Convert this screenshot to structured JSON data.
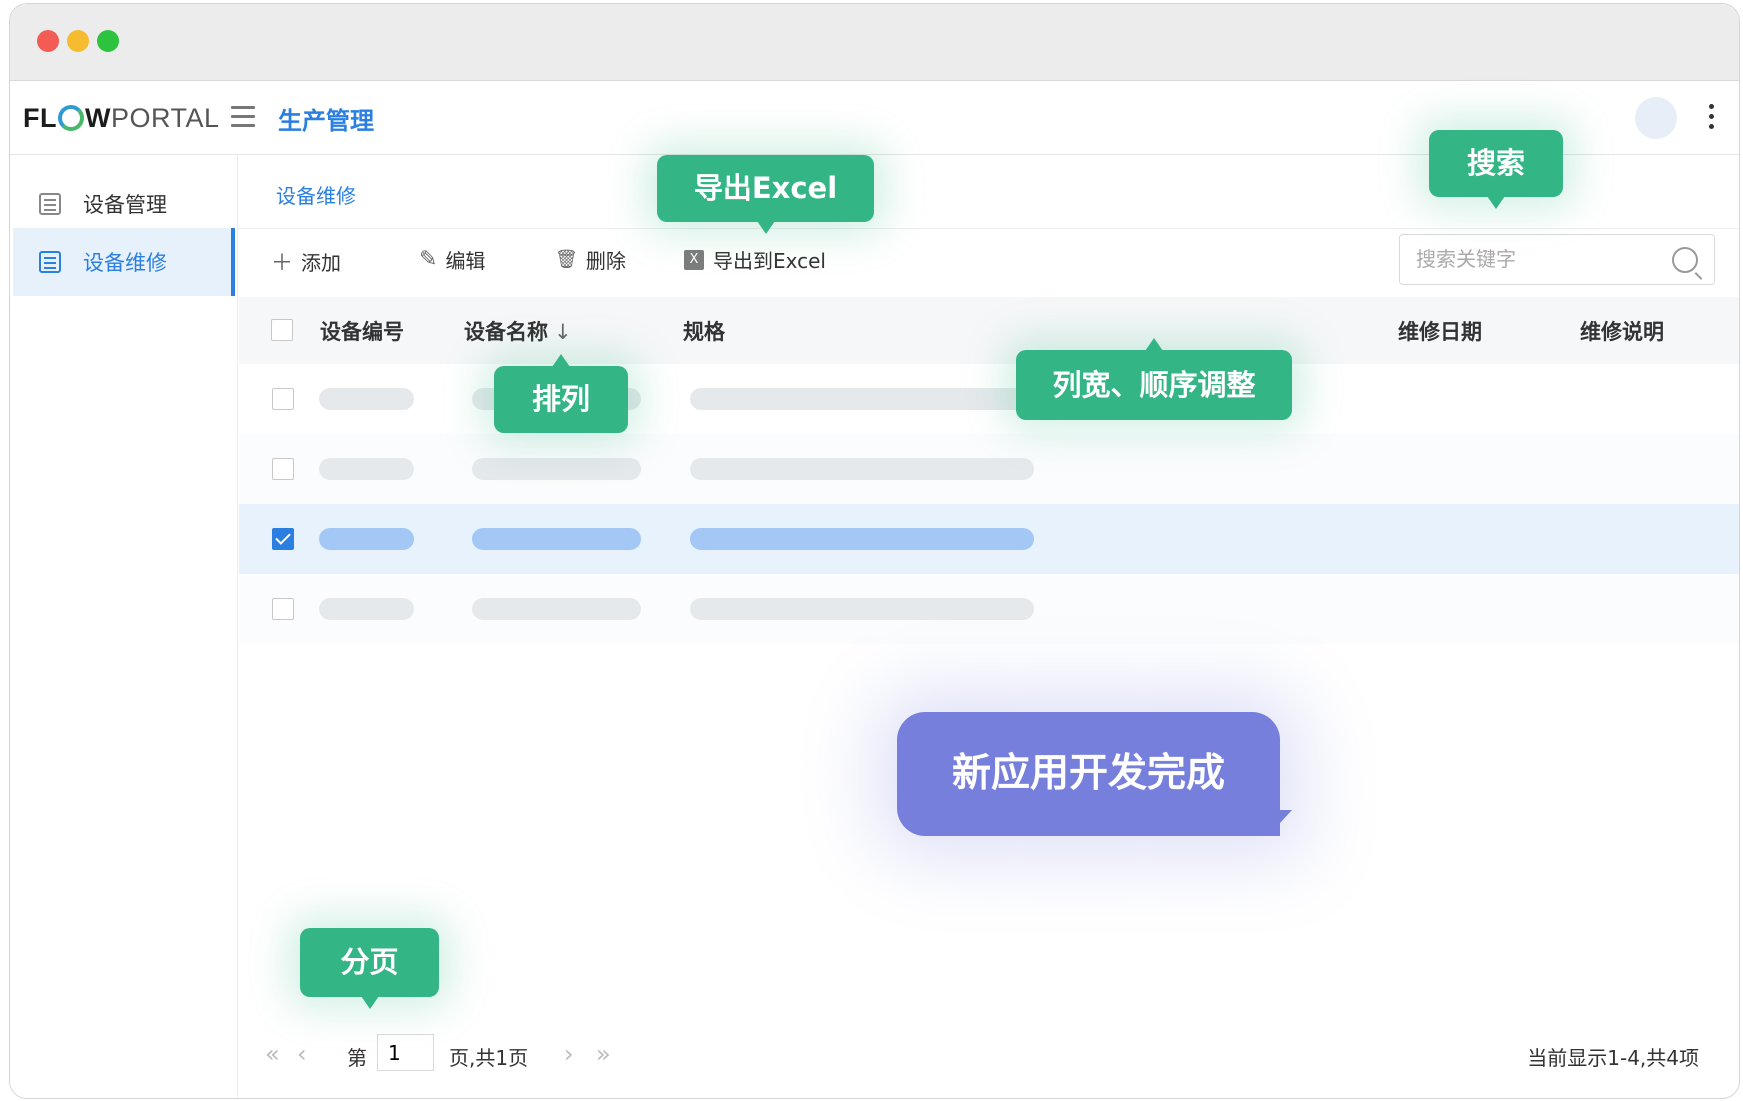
{
  "window": {
    "controls": [
      "close",
      "minimize",
      "zoom"
    ]
  },
  "header": {
    "logo_flow": "FL",
    "logo_w": "W",
    "logo_portal": "PORTAL",
    "app_title": "生产管理"
  },
  "sidebar": {
    "items": [
      {
        "label": "设备管理",
        "icon": "list-icon",
        "active": false
      },
      {
        "label": "设备维修",
        "icon": "list-icon",
        "active": true
      }
    ]
  },
  "breadcrumb": "设备维修",
  "toolbar": {
    "add_label": "添加",
    "edit_label": "编辑",
    "delete_label": "删除",
    "export_label": "导出到Excel",
    "search_placeholder": "搜索关键字"
  },
  "table": {
    "columns": [
      "设备编号",
      "设备名称",
      "规格",
      "维修日期",
      "维修说明"
    ],
    "sort_column": "设备名称",
    "sort_icon": "↓",
    "rows": [
      {
        "checked": false
      },
      {
        "checked": false
      },
      {
        "checked": true
      },
      {
        "checked": false
      }
    ]
  },
  "pager": {
    "page_prefix": "第",
    "page_value": "1",
    "page_suffix": "页,共1页",
    "info": "当前显示1-4,共4项"
  },
  "callouts": {
    "export": "导出Excel",
    "search": "搜索",
    "sort": "排列",
    "columns": "列宽、顺序调整",
    "paging": "分页",
    "final": "新应用开发完成"
  },
  "colors": {
    "accent": "#2a7fe0",
    "callout_green": "#34b585",
    "callout_purple": "#767fdb"
  }
}
